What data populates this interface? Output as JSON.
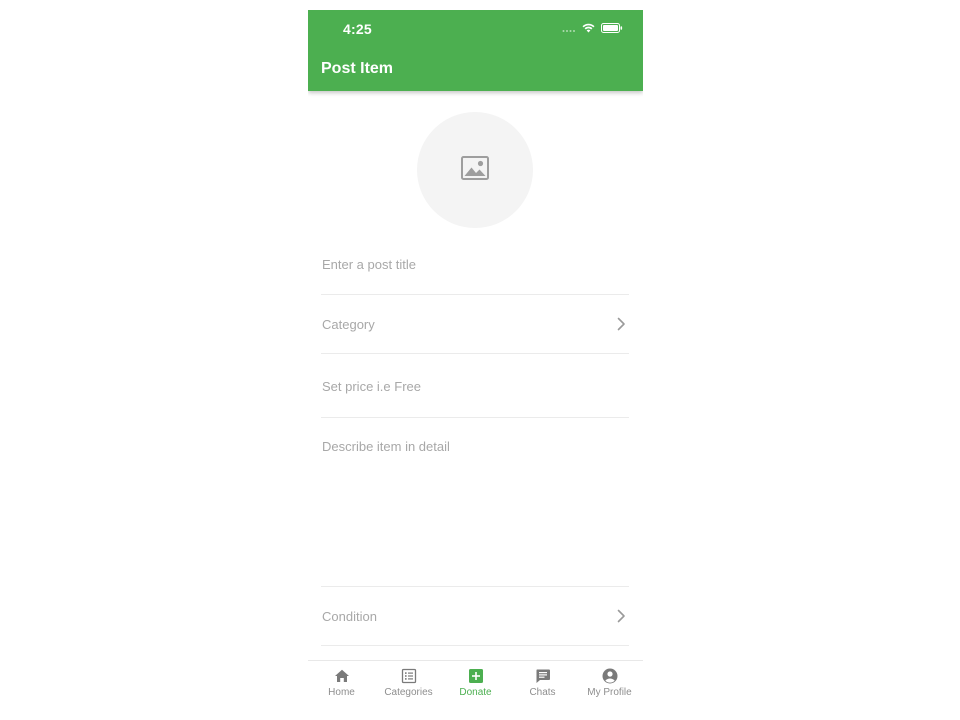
{
  "status_bar": {
    "time": "4:25",
    "icons": [
      "signal-dots-icon",
      "wifi-icon",
      "battery-icon"
    ]
  },
  "app_bar": {
    "title": "Post Item",
    "color": "#4caf50"
  },
  "photo_picker": {
    "icon": "image-placeholder-icon"
  },
  "form": {
    "title_placeholder": "Enter a post title",
    "category_label": "Category",
    "price_placeholder": "Set price i.e Free",
    "description_placeholder": "Describe item in detail",
    "condition_label": "Condition"
  },
  "tab_bar": {
    "active_color": "#4caf50",
    "items": [
      {
        "label": "Home",
        "icon": "home-icon",
        "active": false
      },
      {
        "label": "Categories",
        "icon": "list-icon",
        "active": false
      },
      {
        "label": "Donate",
        "icon": "plus-box-icon",
        "active": true
      },
      {
        "label": "Chats",
        "icon": "chat-icon",
        "active": false
      },
      {
        "label": "My Profile",
        "icon": "account-circle-icon",
        "active": false
      }
    ]
  }
}
